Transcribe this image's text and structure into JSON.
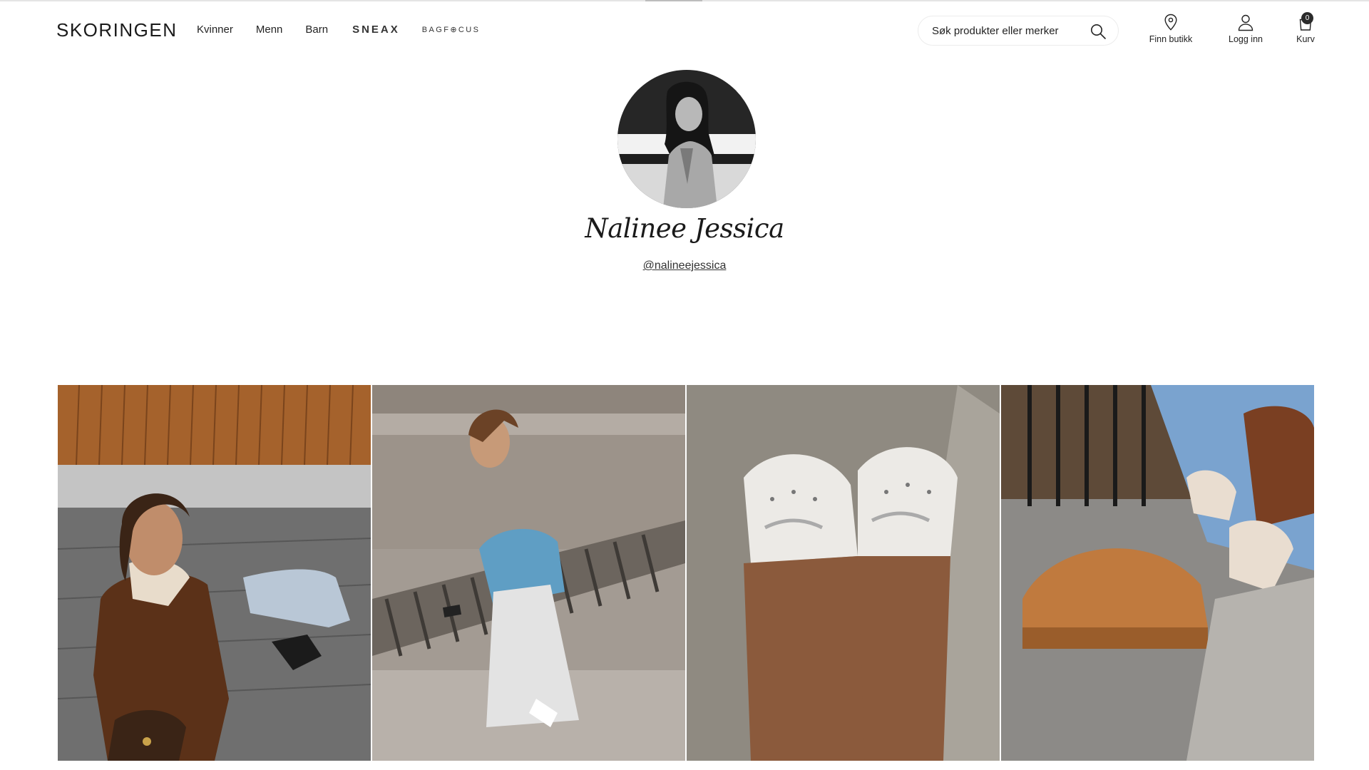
{
  "header": {
    "logo": "SKORINGEN",
    "nav": [
      {
        "label": "Kvinner"
      },
      {
        "label": "Menn"
      },
      {
        "label": "Barn"
      }
    ],
    "brands": {
      "sneax": "SNEAX",
      "bagfocus": "BAGF⊕CUS"
    },
    "search": {
      "placeholder": "Søk produkter eller merker",
      "icon": "search-icon"
    },
    "actions": {
      "find_store": {
        "label": "Finn butikk",
        "icon": "location-pin-icon"
      },
      "login": {
        "label": "Logg inn",
        "icon": "user-icon"
      },
      "cart": {
        "label": "Kurv",
        "icon": "shopping-bag-icon",
        "count": "0"
      }
    }
  },
  "profile": {
    "name": "Nalinee Jessica",
    "handle": "@nalineejessica"
  },
  "gallery": {
    "items": [
      {
        "subject": "woman in brown shearling jacket sitting on steps"
      },
      {
        "subject": "woman in denim jacket sitting on bench"
      },
      {
        "subject": "white ballet flats with bows"
      },
      {
        "subject": "tan platform moccasin shoe being laced"
      }
    ]
  },
  "colors": {
    "text": "#1a1a1a",
    "cart_badge": "#2b2b2b",
    "border": "#ececec"
  }
}
